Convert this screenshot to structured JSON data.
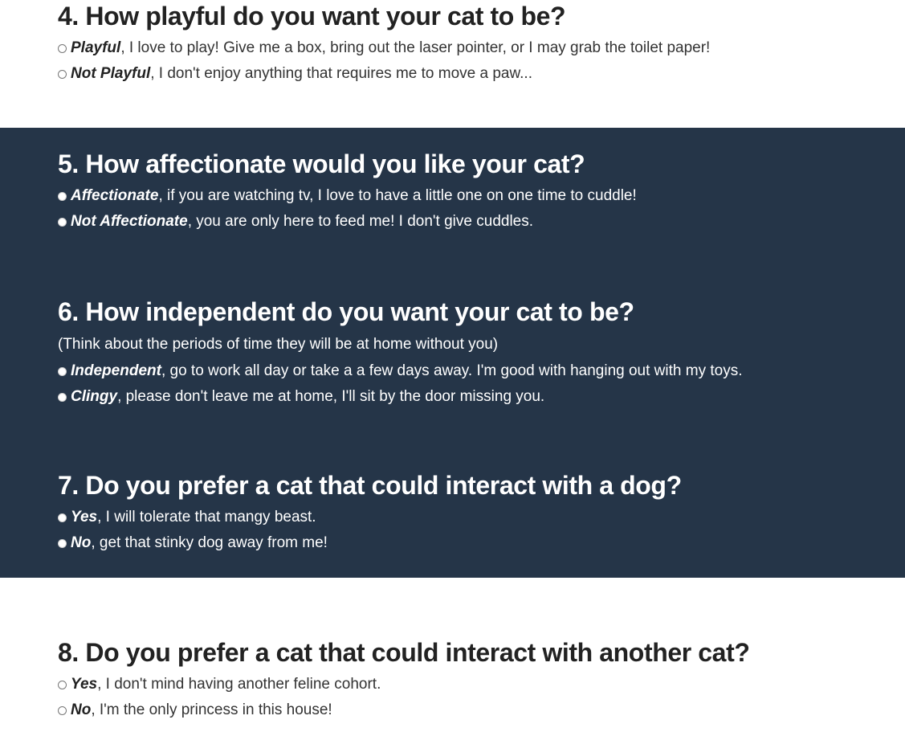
{
  "colors": {
    "dark_band": "#253548",
    "light_band": "#ffffff",
    "dark_text": "#222222",
    "light_text": "#ffffff"
  },
  "questions": [
    {
      "title": "4. How playful do you want your cat to be?",
      "options": [
        {
          "bold": "Playful",
          "rest": ", I love to play! Give me a box, bring out the laser pointer, or I may grab the toilet paper!"
        },
        {
          "bold": "Not Playful",
          "rest": ", I don't enjoy anything that requires me to move a paw..."
        }
      ]
    },
    {
      "title": "5. How affectionate would you like your cat?",
      "options": [
        {
          "bold": "Affectionate",
          "rest": ", if you are watching tv, I love to have a little one on one time to cuddle!"
        },
        {
          "bold": "Not Affectionate",
          "rest": ", you are only here to feed me! I don't give cuddles."
        }
      ]
    },
    {
      "title": "6. How independent do you want your cat to be?",
      "note": "(Think about the periods of time they will be at home without you)",
      "options": [
        {
          "bold": "Independent",
          "rest": ", go to work all day or take a a few days away. I'm good with hanging out with my toys."
        },
        {
          "bold": "Clingy",
          "rest": ", please don't leave me at home, I'll sit by the door missing you."
        }
      ]
    },
    {
      "title": "7. Do you prefer a cat that could interact with a dog?",
      "options": [
        {
          "bold": "Yes",
          "rest": ", I will tolerate that mangy beast."
        },
        {
          "bold": "No",
          "rest": ", get that stinky dog away from me!"
        }
      ]
    },
    {
      "title": "8. Do you prefer a cat that could interact with another cat?",
      "options": [
        {
          "bold": "Yes",
          "rest": ", I don't mind having another feline cohort."
        },
        {
          "bold": "No",
          "rest": ", I'm the only princess in this house!"
        }
      ]
    }
  ]
}
